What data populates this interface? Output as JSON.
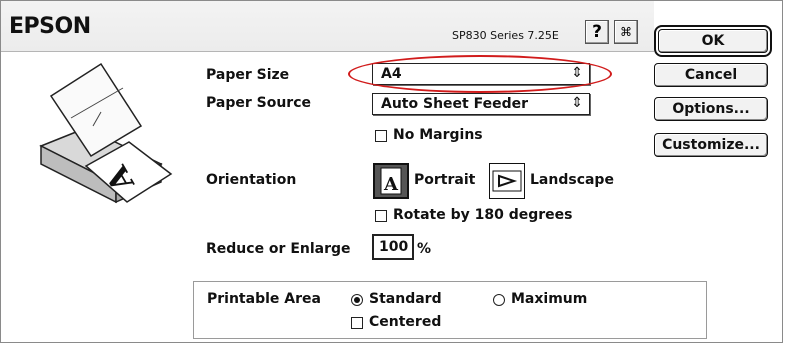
{
  "header": {
    "brand": "EPSON",
    "version": "SP830 Series 7.25E",
    "help_symbol": "?",
    "utility_symbol": "⌘"
  },
  "buttons": {
    "ok": "OK",
    "cancel": "Cancel",
    "options": "Options...",
    "customize": "Customize..."
  },
  "paper_size": {
    "label": "Paper Size",
    "value": "A4",
    "arrow": "⇕"
  },
  "paper_source": {
    "label": "Paper Source",
    "value": "Auto Sheet Feeder",
    "arrow": "⇕"
  },
  "no_margins": {
    "label": "No Margins",
    "checked": false
  },
  "orientation": {
    "label": "Orientation",
    "selected": "portrait",
    "portrait_label": "Portrait",
    "portrait_glyph": "A",
    "landscape_label": "Landscape",
    "rotate_label": "Rotate by 180 degrees",
    "rotate_checked": false
  },
  "reduce": {
    "label": "Reduce or Enlarge",
    "value": "100",
    "unit": "%"
  },
  "printable_area": {
    "label": "Printable Area",
    "selected": "standard",
    "standard_label": "Standard",
    "maximum_label": "Maximum",
    "centered_label": "Centered",
    "centered_checked": false
  },
  "colors": {
    "highlight": "#d11b1b",
    "ink": "#111111"
  }
}
